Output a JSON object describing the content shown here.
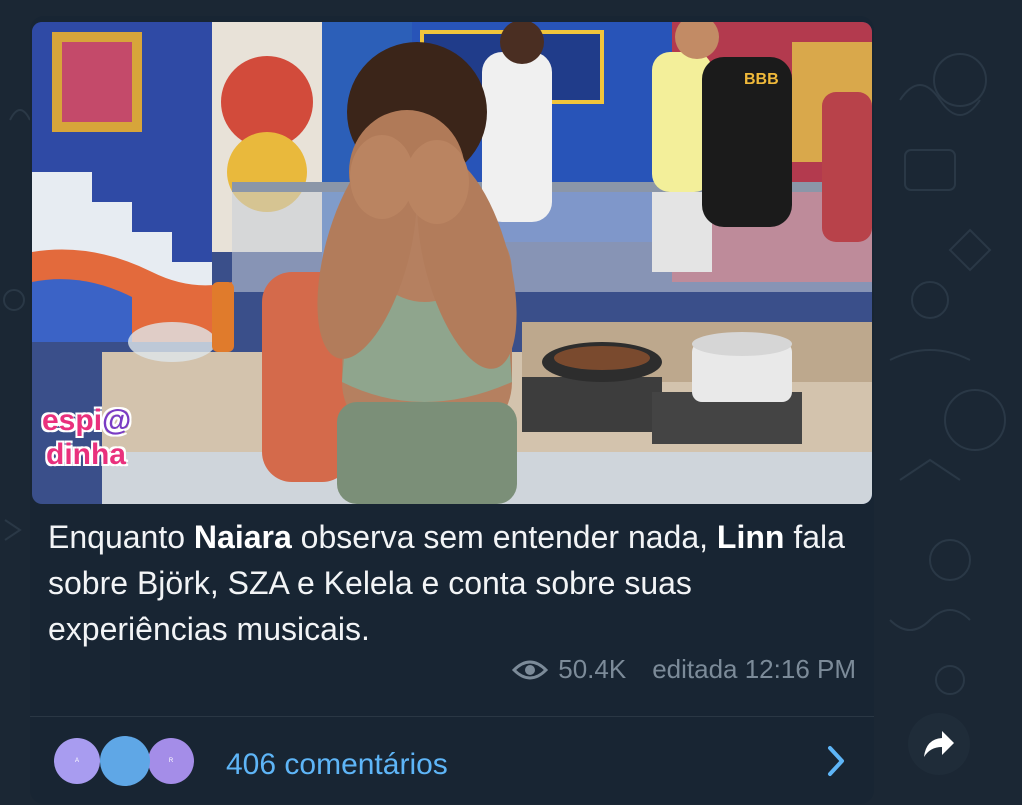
{
  "post": {
    "caption": {
      "seg1": "Enquanto ",
      "bold1": "Naiara",
      "seg2": " observa sem entender nada, ",
      "bold2": "Linn",
      "seg3": " fala sobre Björk, SZA e Kelela e conta sobre suas experiências musicais."
    },
    "logo": {
      "line1": "espi",
      "at": "@",
      "line2": "dinha"
    },
    "tshirt_text": "BBB",
    "views": "50.4K",
    "edited_time": "editada 12:16 PM",
    "comments": {
      "avatars": [
        "A",
        "",
        "R"
      ],
      "avatar_colors": [
        "#a89cf0",
        "#5fa7e6",
        "#a48de8"
      ],
      "label": "406 comentários"
    }
  },
  "icons": {
    "views": "eye-icon",
    "open_comments": "chevron-right-icon",
    "share": "share-arrow-icon"
  },
  "colors": {
    "link": "#5eb5f7",
    "card": "#182533",
    "background": "#1b2734"
  }
}
